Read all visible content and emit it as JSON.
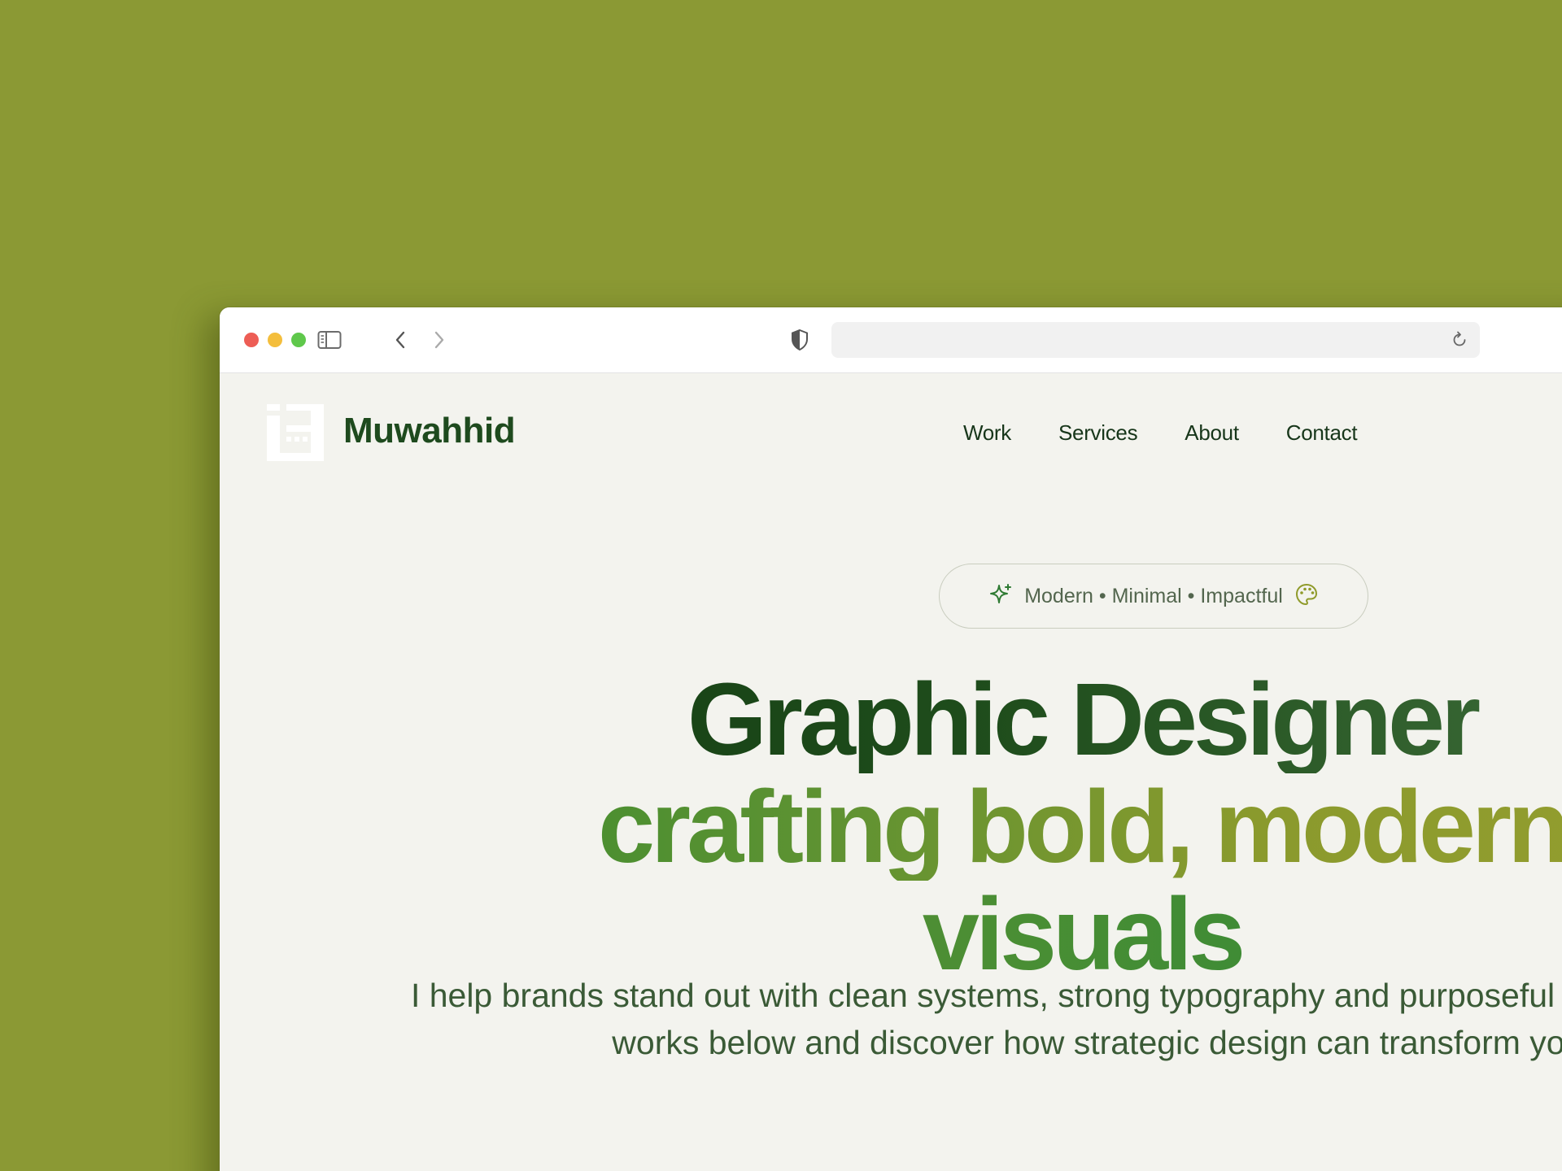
{
  "browser": {
    "url": ""
  },
  "site": {
    "brand": "Muwahhid",
    "nav": [
      {
        "label": "Work"
      },
      {
        "label": "Services"
      },
      {
        "label": "About"
      },
      {
        "label": "Contact"
      }
    ]
  },
  "hero": {
    "tagline": "Modern • Minimal • Impactful",
    "headline_line1": "Graphic Designer",
    "headline_line2": "crafting bold, modern",
    "headline_line3": "visuals",
    "subtext": "I help brands stand out with clean systems, strong typography and purposeful color. Explore selected works below and discover how strategic design can transform your brand."
  },
  "icons": {
    "sparkle": "sparkle-icon",
    "palette": "palette-icon",
    "shield": "shield-icon",
    "sidebar": "sidebar-icon",
    "back": "chevron-left-icon",
    "forward": "chevron-right-icon",
    "reload": "reload-icon"
  },
  "colors": {
    "page_background": "#8b9934",
    "brand_dark_green": "#1e4a1e",
    "accent_olive": "#9aa030",
    "accent_green": "#2f8434"
  }
}
